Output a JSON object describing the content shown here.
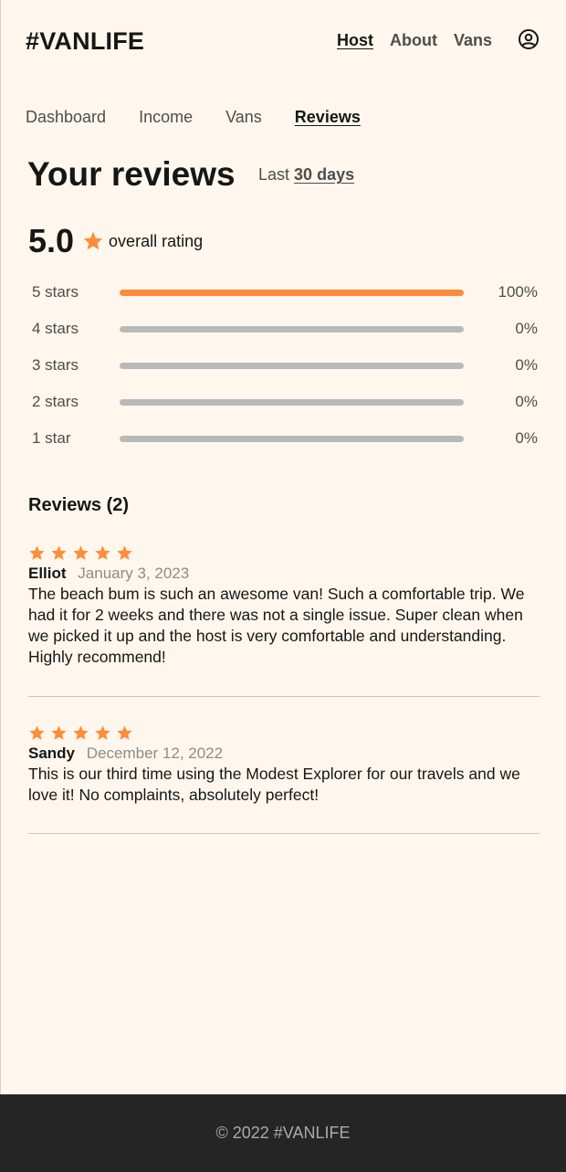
{
  "header": {
    "logo": "#VANLIFE",
    "nav": [
      {
        "label": "Host",
        "active": true
      },
      {
        "label": "About",
        "active": false
      },
      {
        "label": "Vans",
        "active": false
      }
    ],
    "account_icon": "user-circle-icon"
  },
  "host_nav": [
    {
      "label": "Dashboard",
      "active": false
    },
    {
      "label": "Income",
      "active": false
    },
    {
      "label": "Vans",
      "active": false
    },
    {
      "label": "Reviews",
      "active": true
    }
  ],
  "page": {
    "title": "Your reviews",
    "range_prefix": "Last",
    "range_value": "30 days"
  },
  "overall": {
    "score": "5.0",
    "label": "overall rating"
  },
  "rating_breakdown": [
    {
      "label": "5 stars",
      "percent_text": "100%",
      "percent": 100
    },
    {
      "label": "4 stars",
      "percent_text": "0%",
      "percent": 0
    },
    {
      "label": "3 stars",
      "percent_text": "0%",
      "percent": 0
    },
    {
      "label": "2 stars",
      "percent_text": "0%",
      "percent": 0
    },
    {
      "label": "1 star",
      "percent_text": "0%",
      "percent": 0
    }
  ],
  "reviews_heading": "Reviews (2)",
  "reviews": [
    {
      "rating": 5,
      "name": "Elliot",
      "date": "January 3, 2023",
      "text": "The beach bum is such an awesome van! Such a comfortable trip. We had it for 2 weeks and there was not a single issue. Super clean when we picked it up and the host is very comfortable and understanding. Highly recommend!"
    },
    {
      "rating": 5,
      "name": "Sandy",
      "date": "December 12, 2022",
      "text": "This is our third time using the Modest Explorer for our travels and we love it! No complaints, absolutely perfect!"
    }
  ],
  "footer": {
    "text": "© 2022 #VANLIFE"
  },
  "colors": {
    "background": "#FFF7ED",
    "accent": "#FF8C38",
    "bar_track": "#B9B9B9",
    "footer_bg": "#252525",
    "footer_text": "#AAAAAA",
    "muted_text": "#4D4D4D",
    "date_text": "#8C8C8C"
  }
}
